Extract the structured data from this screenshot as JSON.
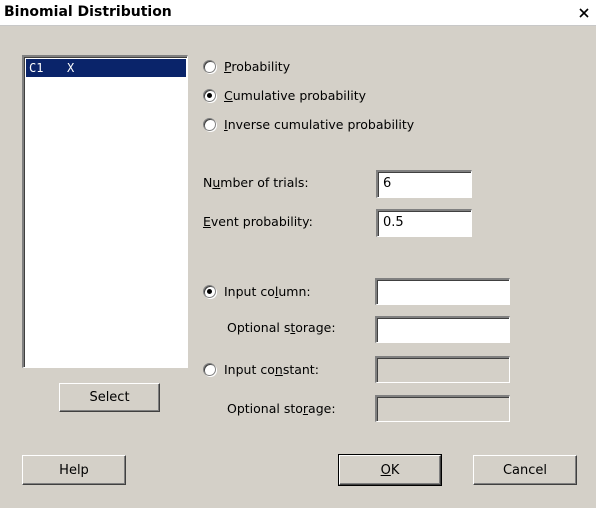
{
  "window": {
    "title": "Binomial Distribution",
    "close_label": "X"
  },
  "list": {
    "rows": [
      {
        "col": "C1",
        "name": "X"
      }
    ]
  },
  "radios_mode": [
    {
      "pre": "",
      "u": "P",
      "post": "robability",
      "checked": false
    },
    {
      "pre": "",
      "u": "C",
      "post": "umulative probability",
      "checked": true
    },
    {
      "pre": "",
      "u": "I",
      "post": "nverse cumulative probability",
      "checked": false
    }
  ],
  "trials": {
    "pre": "N",
    "u": "u",
    "post": "mber of trials:",
    "value": "6"
  },
  "event": {
    "pre": "",
    "u": "E",
    "post": "vent probability:",
    "value": "0.5"
  },
  "input_column": {
    "pre": "Input co",
    "u": "l",
    "post": "umn:",
    "checked": true,
    "value": ""
  },
  "storage1": {
    "pre": "Optional s",
    "u": "t",
    "post": "orage:",
    "value": ""
  },
  "input_constant": {
    "pre": "Input co",
    "u": "n",
    "post": "stant:",
    "checked": false,
    "value": ""
  },
  "storage2": {
    "pre": "Optional sto",
    "u": "r",
    "post": "age:",
    "value": ""
  },
  "buttons": {
    "select": "Select",
    "help": "Help",
    "ok_u": "O",
    "ok_post": "K",
    "cancel": "Cancel"
  }
}
